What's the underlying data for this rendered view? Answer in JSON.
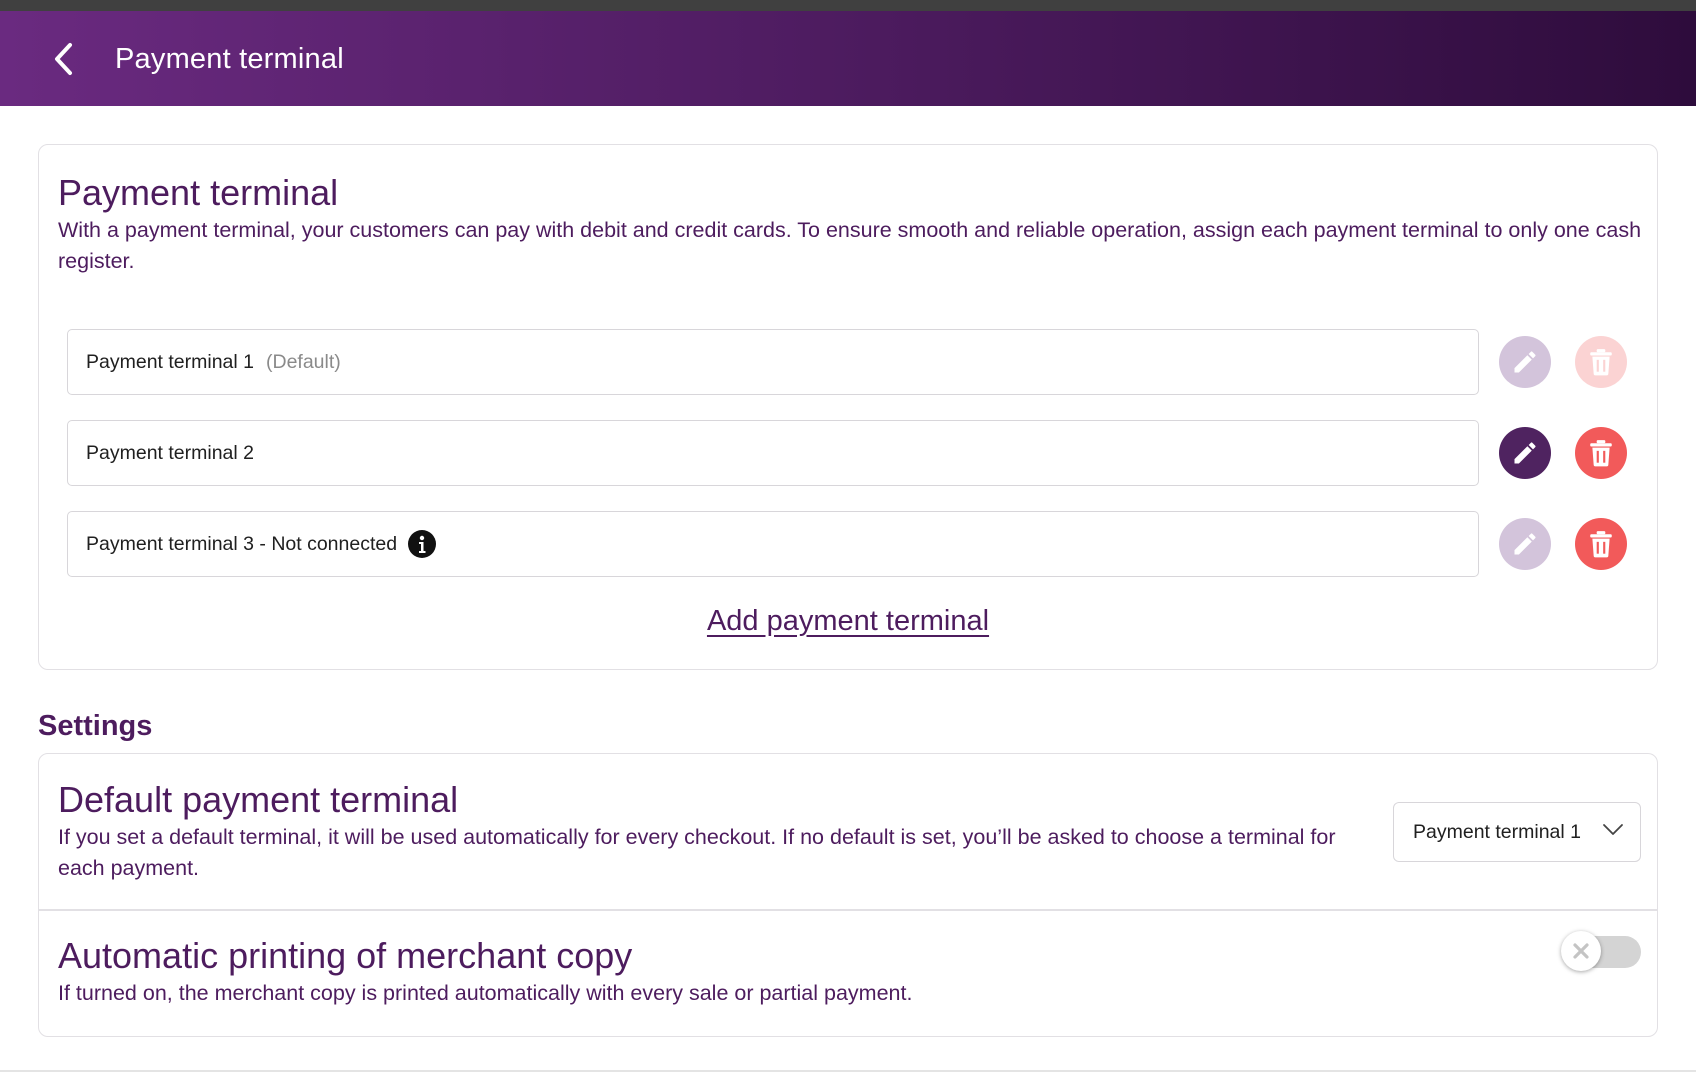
{
  "appbar": {
    "title": "Payment terminal",
    "back_icon": "chevron-left-icon"
  },
  "terminals_card": {
    "title": "Payment terminal",
    "description": "With a payment terminal, your customers can pay with debit and credit cards. To ensure smooth and reliable operation, assign each payment terminal to only one cash register.",
    "items": [
      {
        "name": "Payment terminal 1",
        "tag": "(Default)",
        "edit_enabled": false,
        "delete_enabled": false,
        "info_icon": false
      },
      {
        "name": "Payment terminal 2",
        "tag": "",
        "edit_enabled": true,
        "delete_enabled": true,
        "info_icon": false
      },
      {
        "name": "Payment terminal 3 - Not connected",
        "tag": "",
        "edit_enabled": false,
        "delete_enabled": true,
        "info_icon": true
      }
    ],
    "add_link": "Add payment terminal"
  },
  "settings": {
    "heading": "Settings",
    "default_terminal": {
      "title": "Default payment terminal",
      "description": "If you set a default terminal, it will be used automatically for every checkout. If no default is set, you’ll be asked to choose a terminal for each payment.",
      "selected": "Payment terminal 1"
    },
    "merchant_copy": {
      "title": "Automatic printing of merchant copy",
      "description": "If turned on, the merchant copy is printed automatically with every sale or partial payment.",
      "enabled": false
    }
  },
  "colors": {
    "brand_purple": "#4d1c5e",
    "header_gradient_start": "#6a2a80",
    "header_gradient_end": "#2e0c3c",
    "edit_active": "#4f2360",
    "edit_disabled": "#d3c4db",
    "delete_active": "#f25a5a",
    "delete_disabled": "#fbd3d3",
    "toggle_off_track": "#d4d4d4"
  },
  "icons": {
    "edit": "pencil-icon",
    "delete": "trash-icon",
    "info": "info-icon",
    "select": "chevron-down-icon",
    "toggle_off": "close-icon"
  }
}
